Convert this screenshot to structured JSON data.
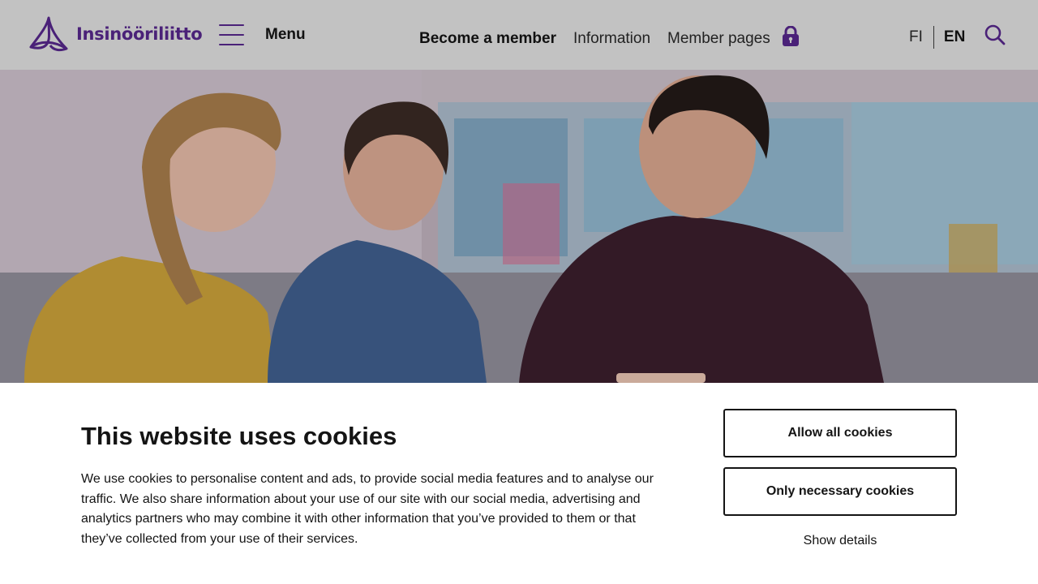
{
  "header": {
    "logo_text": "Insinööriliitto",
    "menu_label": "Menu",
    "nav": {
      "become_member": "Become a member",
      "information": "Information",
      "member_pages": "Member pages"
    },
    "languages": {
      "fi": "FI",
      "en": "EN",
      "active": "EN"
    },
    "icons": [
      "logo-icon",
      "hamburger-icon",
      "lock-icon",
      "search-icon"
    ]
  },
  "hero": {
    "image_alt": ""
  },
  "cookie_banner": {
    "title": "This website uses cookies",
    "body": "We use cookies to personalise content and ads, to provide social media features and to analyse our traffic. We also share information about your use of our site with our social media, advertising and analytics partners who may combine it with other information that you’ve provided to them or that they’ve collected from your use of their services.",
    "allow_all_label": "Allow all cookies",
    "only_necessary_label": "Only necessary cookies",
    "show_details_label": "Show details"
  },
  "colors": {
    "brand_purple": "#4a2178",
    "header_bg": "#c2c2c2",
    "text_dark": "#141414"
  }
}
